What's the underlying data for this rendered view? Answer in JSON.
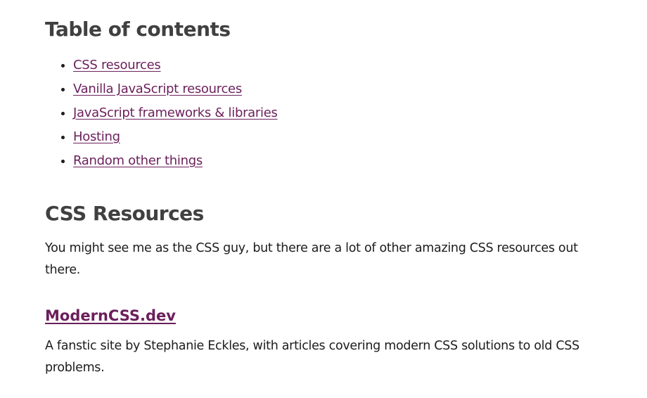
{
  "toc": {
    "heading": "Table of contents",
    "items": [
      {
        "label": "CSS resources"
      },
      {
        "label": "Vanilla JavaScript resources"
      },
      {
        "label": "JavaScript frameworks & libraries"
      },
      {
        "label": "Hosting"
      },
      {
        "label": "Random other things"
      }
    ]
  },
  "css_section": {
    "heading": "CSS Resources",
    "intro": "You might see me as the CSS guy, but there are a lot of other amazing CSS resources out there.",
    "resources": [
      {
        "title": "ModernCSS.dev",
        "description": "A fanstic site by Stephanie Eckles, with articles covering modern CSS solutions to old CSS problems."
      }
    ]
  },
  "colors": {
    "link": "#6b1f5a",
    "heading": "#404040",
    "text": "#1c1c1c"
  }
}
